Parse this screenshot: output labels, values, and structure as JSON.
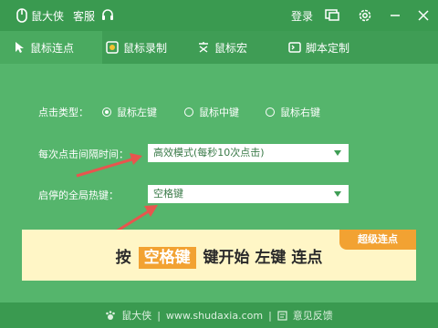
{
  "titlebar": {
    "app_name": "鼠大侠",
    "service_label": "客服",
    "login_label": "登录",
    "icons": [
      "headset-icon",
      "screen-icon",
      "gear-icon",
      "minimize-icon",
      "close-icon"
    ]
  },
  "tabs": [
    {
      "label": "鼠标连点",
      "icon": "cursor-icon",
      "active": true
    },
    {
      "label": "鼠标录制",
      "icon": "record-icon",
      "active": false
    },
    {
      "label": "鼠标宏",
      "icon": "macro-icon",
      "active": false
    },
    {
      "label": "脚本定制",
      "icon": "script-icon",
      "active": false
    }
  ],
  "settings": {
    "click_type_label": "点击类型：",
    "click_options": [
      {
        "label": "鼠标左键",
        "selected": true
      },
      {
        "label": "鼠标中键",
        "selected": false
      },
      {
        "label": "鼠标右键",
        "selected": false
      }
    ],
    "interval_label": "每次点击间隔时间：",
    "interval_value": "高效模式(每秒10次点击)",
    "hotkey_label": "启停的全局热键：",
    "hotkey_value": "空格键"
  },
  "banner": {
    "part1": "按",
    "key": "空格键",
    "part2": "键开始",
    "part3": "左键",
    "part4": "连点",
    "badge": "超级连点"
  },
  "footer": {
    "brand": "鼠大侠",
    "url": "www.shudaxia.com",
    "feedback": "意见反馈"
  },
  "colors": {
    "header": "#3a9a50",
    "content": "#55b56c",
    "accent": "#f2a232",
    "arrow": "#e8554e",
    "banner": "#fff6c6"
  }
}
